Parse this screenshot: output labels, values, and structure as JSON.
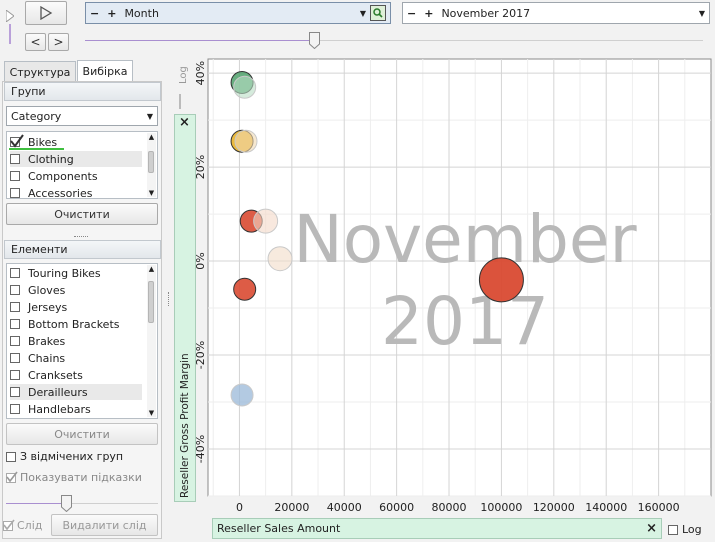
{
  "top": {
    "time_dim": "Month",
    "time_value": "November 2017",
    "minus": "−",
    "plus": "+"
  },
  "tabs": {
    "structure": "Структура",
    "selection": "Вибірка"
  },
  "groups": {
    "title": "Групи",
    "dropdown_value": "Category",
    "items": [
      {
        "label": "Bikes",
        "checked": true
      },
      {
        "label": "Clothing",
        "checked": false
      },
      {
        "label": "Components",
        "checked": false
      },
      {
        "label": "Accessories",
        "checked": false
      }
    ],
    "clear_label": "Очистити"
  },
  "elements": {
    "title": "Елементи",
    "items": [
      {
        "label": "Touring Bikes"
      },
      {
        "label": "Gloves"
      },
      {
        "label": "Jerseys"
      },
      {
        "label": "Bottom Brackets"
      },
      {
        "label": "Brakes"
      },
      {
        "label": "Chains"
      },
      {
        "label": "Cranksets"
      },
      {
        "label": "Derailleurs"
      },
      {
        "label": "Handlebars"
      }
    ],
    "clear_label": "Очистити",
    "from_checked_groups": "З відмічених груп",
    "show_hints": "Показувати підказки",
    "trail_label": "Слід",
    "delete_trail": "Видалити слід"
  },
  "axes": {
    "y_measure": "Reseller Gross Profit Margin",
    "x_measure": "Reseller Sales Amount",
    "log_label": "Log",
    "close_glyph": "×"
  },
  "chart_data": {
    "type": "scatter",
    "title": "",
    "watermark": [
      "November",
      "2017"
    ],
    "x_ticks": [
      "0",
      "20000",
      "40000",
      "60000",
      "80000",
      "100000",
      "120000",
      "140000",
      "160000"
    ],
    "y_ticks": [
      "40%",
      "20%",
      "0%",
      "-20%",
      "-40%"
    ],
    "xlim": [
      -12000,
      180000
    ],
    "ylim": [
      -0.5,
      0.43
    ],
    "grid": true,
    "points": [
      {
        "x": 1000,
        "y": 0.38,
        "size": 11,
        "color": "#4da06a",
        "alpha": 0.85
      },
      {
        "x": 2000,
        "y": 0.37,
        "size": 11,
        "color": "#b9ddc4",
        "alpha": 0.6
      },
      {
        "x": 1000,
        "y": 0.255,
        "size": 11,
        "color": "#e8b22a",
        "alpha": 0.9
      },
      {
        "x": 2500,
        "y": 0.255,
        "size": 11,
        "color": "#f0d9b0",
        "alpha": 0.6
      },
      {
        "x": 4500,
        "y": 0.085,
        "size": 11,
        "color": "#d94a32",
        "alpha": 0.9
      },
      {
        "x": 10000,
        "y": 0.085,
        "size": 12,
        "color": "#f4d8c8",
        "alpha": 0.6
      },
      {
        "x": 15500,
        "y": 0.005,
        "size": 12,
        "color": "#f2dcc8",
        "alpha": 0.6
      },
      {
        "x": 2000,
        "y": -0.06,
        "size": 11,
        "color": "#d94a32",
        "alpha": 0.9
      },
      {
        "x": 100000,
        "y": -0.04,
        "size": 22,
        "color": "#d94a32",
        "alpha": 0.95
      },
      {
        "x": 1000,
        "y": -0.285,
        "size": 11,
        "color": "#9ab8d8",
        "alpha": 0.75
      }
    ]
  }
}
